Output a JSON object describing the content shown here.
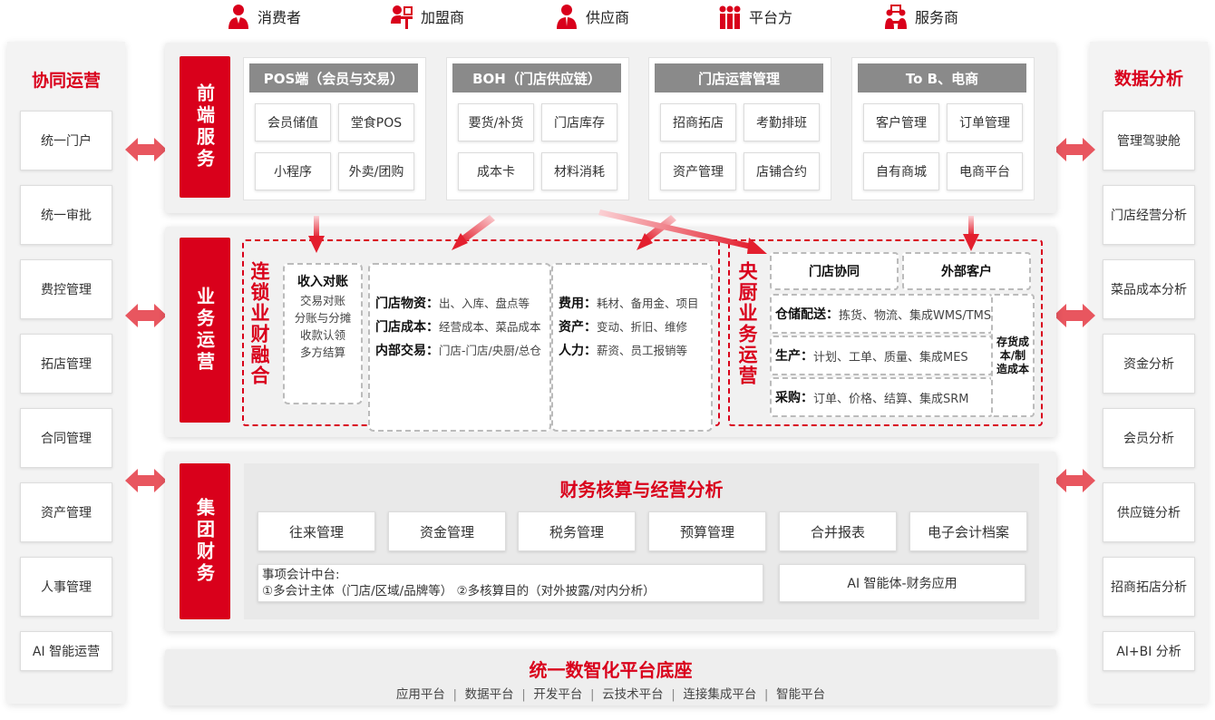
{
  "roles": [
    "消费者",
    "加盟商",
    "供应商",
    "平台方",
    "服务商"
  ],
  "left": {
    "title": "协同运营",
    "items": [
      "统一门户",
      "统一审批",
      "费控管理",
      "拓店管理",
      "合同管理",
      "资产管理",
      "人事管理",
      "AI 智能运营"
    ]
  },
  "right": {
    "title": "数据分析",
    "items": [
      "管理驾驶舱",
      "门店经营分析",
      "菜品成本分析",
      "资金分析",
      "会员分析",
      "供应链分析",
      "招商拓店分析",
      "AI+BI 分析"
    ]
  },
  "front": {
    "label": "前端服务",
    "groups": [
      {
        "title": "POS端（会员与交易）",
        "cells": [
          "会员储值",
          "堂食POS",
          "小程序",
          "外卖/团购"
        ]
      },
      {
        "title": "BOH（门店供应链）",
        "cells": [
          "要货/补货",
          "门店库存",
          "成本卡",
          "材料消耗"
        ]
      },
      {
        "title": "门店运营管理",
        "cells": [
          "招商拓店",
          "考勤排班",
          "资产管理",
          "店铺合约"
        ]
      },
      {
        "title": "To B、电商",
        "cells": [
          "客户管理",
          "订单管理",
          "自有商城",
          "电商平台"
        ]
      }
    ]
  },
  "business": {
    "label": "业务运营",
    "chain": {
      "title": "连锁业财融合",
      "income": {
        "title": "收入对账",
        "lines": [
          "交易对账",
          "分账与分摊",
          "收款认领",
          "多方结算"
        ]
      },
      "store": [
        {
          "k": "门店物资：",
          "v": "出、入库、盘点等"
        },
        {
          "k": "门店成本：",
          "v": "经营成本、菜品成本"
        },
        {
          "k": "内部交易：",
          "v": "门店-门店/央厨/总仓"
        }
      ],
      "cost": [
        {
          "k": "费用：",
          "v": "耗材、备用金、项目"
        },
        {
          "k": "资产：",
          "v": "变动、折旧、维修"
        },
        {
          "k": "人力：",
          "v": "薪资、员工报销等"
        }
      ]
    },
    "kitchen": {
      "title": "央厨业务运营",
      "top": [
        "门店协同",
        "外部客户"
      ],
      "rows": [
        {
          "k": "仓储配送：",
          "v": "拣货、物流、集成WMS/TMS"
        },
        {
          "k": "生产：",
          "v": "计划、工单、质量、集成MES"
        },
        {
          "k": "采购：",
          "v": "订单、价格、结算、集成SRM"
        }
      ],
      "side": "存货成本/制造成本"
    }
  },
  "finance": {
    "label": "集团财务",
    "title": "财务核算与经营分析",
    "cells": [
      "往来管理",
      "资金管理",
      "税务管理",
      "预算管理",
      "合并报表",
      "电子会计档案"
    ],
    "matter_title": "事项会计中台:",
    "matter_detail": "①多会计主体（门店/区域/品牌等） ②多核算目的（对外披露/对内分析）",
    "ai": "AI 智能体-财务应用"
  },
  "base": {
    "title": "统一数智化平台底座",
    "items": [
      "应用平台",
      "数据平台",
      "开发平台",
      "云技术平台",
      "连接集成平台",
      "智能平台"
    ]
  },
  "colors": {
    "accent": "#d9001b",
    "header_gray": "#8a8a8a"
  }
}
